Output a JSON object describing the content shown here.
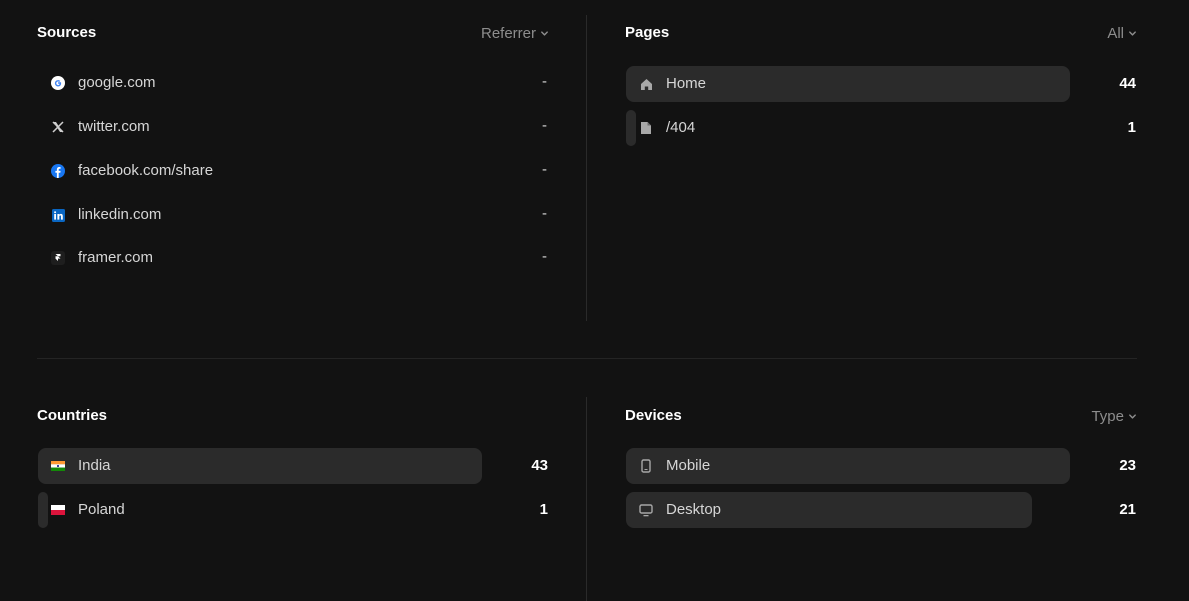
{
  "sources": {
    "title": "Sources",
    "filter": "Referrer",
    "items": [
      {
        "label": "google.com",
        "value": "-",
        "icon": "google-icon"
      },
      {
        "label": "twitter.com",
        "value": "-",
        "icon": "x-icon"
      },
      {
        "label": "facebook.com/share",
        "value": "-",
        "icon": "facebook-icon"
      },
      {
        "label": "linkedin.com",
        "value": "-",
        "icon": "linkedin-icon"
      },
      {
        "label": "framer.com",
        "value": "-",
        "icon": "framer-icon"
      }
    ]
  },
  "pages": {
    "title": "Pages",
    "filter": "All",
    "items": [
      {
        "label": "Home",
        "value": "44",
        "icon": "home-icon"
      },
      {
        "label": "/404",
        "value": "1",
        "icon": "file-icon"
      }
    ]
  },
  "countries": {
    "title": "Countries",
    "items": [
      {
        "label": "India",
        "value": "43",
        "icon": "india-flag-icon"
      },
      {
        "label": "Poland",
        "value": "1",
        "icon": "poland-flag-icon"
      }
    ]
  },
  "devices": {
    "title": "Devices",
    "filter": "Type",
    "items": [
      {
        "label": "Mobile",
        "value": "23",
        "icon": "mobile-icon"
      },
      {
        "label": "Desktop",
        "value": "21",
        "icon": "desktop-icon"
      }
    ]
  },
  "colors": {
    "background": "#121212",
    "bar": "#2b2b2b",
    "muted": "#8d8d8d"
  }
}
